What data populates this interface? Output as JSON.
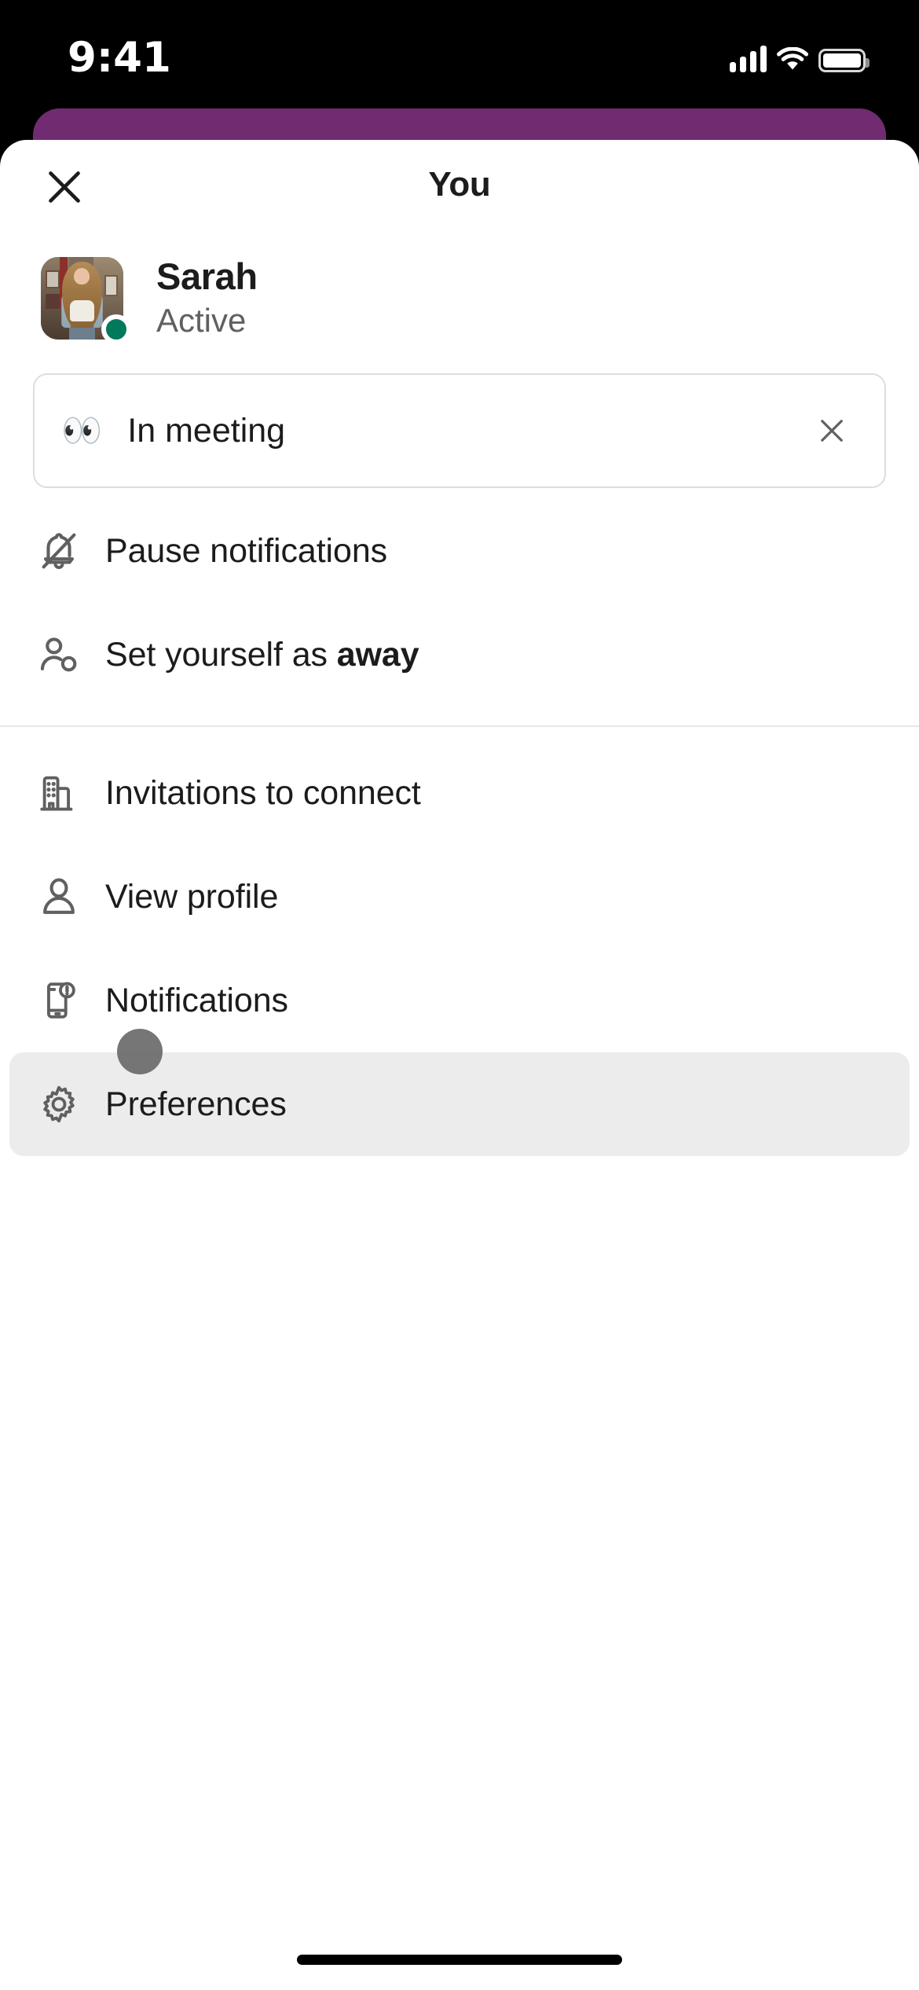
{
  "status_bar": {
    "time": "9:41",
    "cellular_icon": "cellular-signal-icon",
    "wifi_icon": "wifi-icon",
    "battery_icon": "battery-icon"
  },
  "background_card": {
    "color": "#702B71"
  },
  "sheet": {
    "title": "You",
    "close_icon": "close-icon"
  },
  "profile": {
    "avatar_icon": "user-avatar-photo",
    "name": "Sarah",
    "presence": "Active",
    "presence_dot_color": "#007A5A"
  },
  "status_field": {
    "emoji": "👀",
    "emoji_name": "eyes-emoji",
    "text": "In meeting",
    "clear_icon": "close-icon",
    "border_color": "#DDDDDD"
  },
  "menu": {
    "group_one": [
      {
        "label": "Pause notifications",
        "icon": "bell-slash-icon",
        "bold_suffix": ""
      },
      {
        "label": "Set yourself as ",
        "icon": "person-away-icon",
        "bold_suffix": "away"
      }
    ],
    "group_two": [
      {
        "label": "Invitations to connect",
        "icon": "building-icon",
        "bold_suffix": ""
      },
      {
        "label": "View profile",
        "icon": "person-icon",
        "bold_suffix": ""
      },
      {
        "label": "Notifications",
        "icon": "mobile-bell-icon",
        "bold_suffix": ""
      },
      {
        "label": "Preferences",
        "icon": "gear-icon",
        "bold_suffix": "",
        "highlighted": true
      }
    ]
  },
  "touch_indicator": {
    "name": "touch-point-indicator",
    "color": "#6F6F6F"
  },
  "home_indicator": {
    "name": "home-indicator"
  }
}
